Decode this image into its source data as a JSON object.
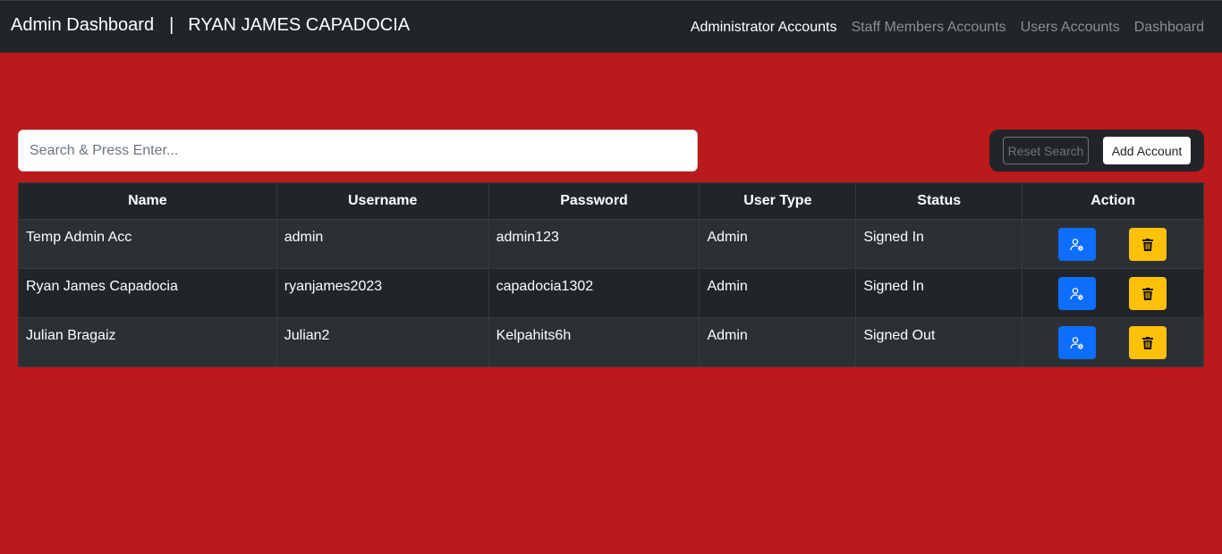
{
  "navbar": {
    "title": "Admin Dashboard",
    "separator": "|",
    "user": "RYAN JAMES CAPADOCIA",
    "links": [
      {
        "label": "Administrator Accounts",
        "active": true
      },
      {
        "label": "Staff Members Accounts",
        "active": false
      },
      {
        "label": "Users Accounts",
        "active": false
      },
      {
        "label": "Dashboard",
        "active": false
      }
    ]
  },
  "search": {
    "placeholder": "Search & Press Enter..."
  },
  "toolbar": {
    "reset_label": "Reset Search",
    "add_label": "Add Account"
  },
  "table": {
    "headers": [
      "Name",
      "Username",
      "Password",
      "User Type",
      "Status",
      "Action"
    ],
    "rows": [
      {
        "name": "Temp Admin Acc",
        "username": "admin",
        "password": "admin123",
        "user_type": "Admin",
        "status": "Signed In"
      },
      {
        "name": "Ryan James Capadocia",
        "username": "ryanjames2023",
        "password": "capadocia1302",
        "user_type": "Admin",
        "status": "Signed In"
      },
      {
        "name": "Julian Bragaiz",
        "username": "Julian2",
        "password": "Kelpahits6h",
        "user_type": "Admin",
        "status": "Signed Out"
      }
    ],
    "action_icons": {
      "edit": "user-gear-icon",
      "delete": "trash-icon"
    }
  },
  "colors": {
    "background": "#bb191b",
    "navbar": "#212529",
    "edit_button": "#0d6efd",
    "delete_button": "#ffc107"
  }
}
